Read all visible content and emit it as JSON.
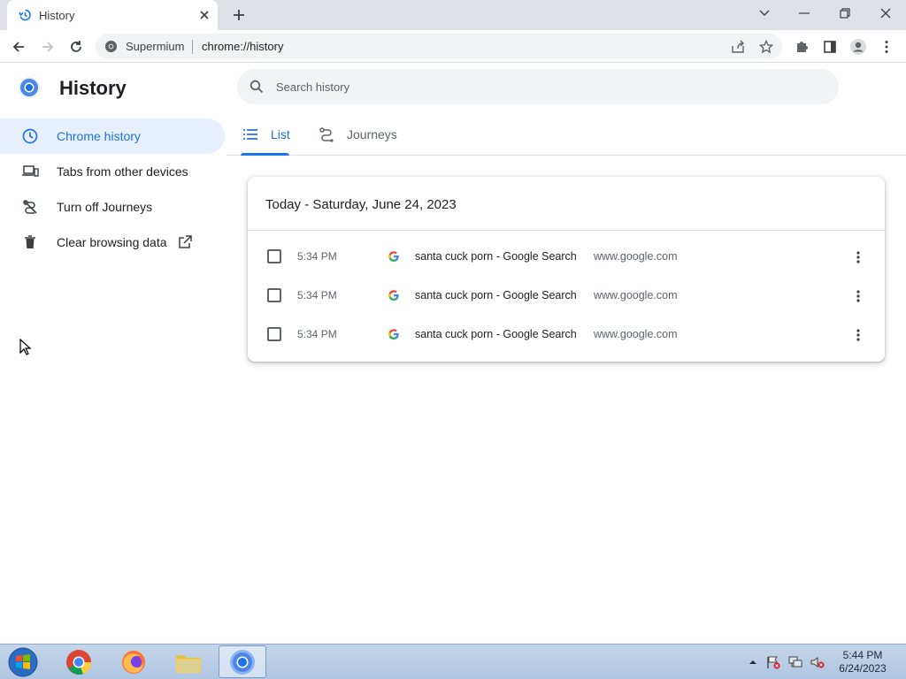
{
  "browser": {
    "tab_title": "History",
    "site_name": "Supermium",
    "url": "chrome://history"
  },
  "page": {
    "title": "History",
    "search_placeholder": "Search history"
  },
  "sidebar": {
    "items": [
      {
        "label": "Chrome history",
        "icon": "clock-icon",
        "active": true
      },
      {
        "label": "Tabs from other devices",
        "icon": "devices-icon",
        "active": false
      },
      {
        "label": "Turn off Journeys",
        "icon": "journeys-off-icon",
        "active": false
      },
      {
        "label": "Clear browsing data",
        "icon": "trash-icon",
        "active": false
      }
    ]
  },
  "tabs": [
    {
      "label": "List",
      "icon": "list-icon",
      "active": true
    },
    {
      "label": "Journeys",
      "icon": "journeys-icon",
      "active": false
    }
  ],
  "history": {
    "date_heading": "Today - Saturday, June 24, 2023",
    "entries": [
      {
        "time": "5:34 PM",
        "title": "santa cuck porn - Google Search",
        "domain": "www.google.com"
      },
      {
        "time": "5:34 PM",
        "title": "santa cuck porn - Google Search",
        "domain": "www.google.com"
      },
      {
        "time": "5:34 PM",
        "title": "santa cuck porn - Google Search",
        "domain": "www.google.com"
      }
    ]
  },
  "taskbar": {
    "time": "5:44 PM",
    "date": "6/24/2023"
  },
  "colors": {
    "accent": "#1a73e8",
    "active_bg": "#e8f0fe",
    "tabstrip": "#dee1e6"
  }
}
